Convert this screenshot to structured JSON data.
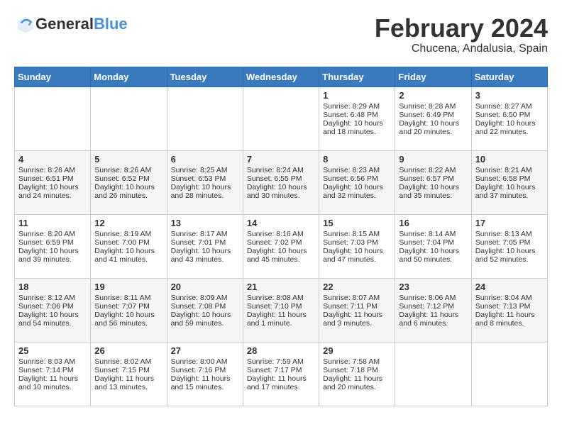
{
  "header": {
    "logo_general": "General",
    "logo_blue": "Blue",
    "title": "February 2024",
    "subtitle": "Chucena, Andalusia, Spain"
  },
  "weekdays": [
    "Sunday",
    "Monday",
    "Tuesday",
    "Wednesday",
    "Thursday",
    "Friday",
    "Saturday"
  ],
  "weeks": [
    [
      {
        "day": "",
        "empty": true
      },
      {
        "day": "",
        "empty": true
      },
      {
        "day": "",
        "empty": true
      },
      {
        "day": "",
        "empty": true
      },
      {
        "day": "1",
        "sunrise": "Sunrise: 8:29 AM",
        "sunset": "Sunset: 6:48 PM",
        "daylight": "Daylight: 10 hours and 18 minutes."
      },
      {
        "day": "2",
        "sunrise": "Sunrise: 8:28 AM",
        "sunset": "Sunset: 6:49 PM",
        "daylight": "Daylight: 10 hours and 20 minutes."
      },
      {
        "day": "3",
        "sunrise": "Sunrise: 8:27 AM",
        "sunset": "Sunset: 6:50 PM",
        "daylight": "Daylight: 10 hours and 22 minutes."
      }
    ],
    [
      {
        "day": "4",
        "sunrise": "Sunrise: 8:26 AM",
        "sunset": "Sunset: 6:51 PM",
        "daylight": "Daylight: 10 hours and 24 minutes."
      },
      {
        "day": "5",
        "sunrise": "Sunrise: 8:26 AM",
        "sunset": "Sunset: 6:52 PM",
        "daylight": "Daylight: 10 hours and 26 minutes."
      },
      {
        "day": "6",
        "sunrise": "Sunrise: 8:25 AM",
        "sunset": "Sunset: 6:53 PM",
        "daylight": "Daylight: 10 hours and 28 minutes."
      },
      {
        "day": "7",
        "sunrise": "Sunrise: 8:24 AM",
        "sunset": "Sunset: 6:55 PM",
        "daylight": "Daylight: 10 hours and 30 minutes."
      },
      {
        "day": "8",
        "sunrise": "Sunrise: 8:23 AM",
        "sunset": "Sunset: 6:56 PM",
        "daylight": "Daylight: 10 hours and 32 minutes."
      },
      {
        "day": "9",
        "sunrise": "Sunrise: 8:22 AM",
        "sunset": "Sunset: 6:57 PM",
        "daylight": "Daylight: 10 hours and 35 minutes."
      },
      {
        "day": "10",
        "sunrise": "Sunrise: 8:21 AM",
        "sunset": "Sunset: 6:58 PM",
        "daylight": "Daylight: 10 hours and 37 minutes."
      }
    ],
    [
      {
        "day": "11",
        "sunrise": "Sunrise: 8:20 AM",
        "sunset": "Sunset: 6:59 PM",
        "daylight": "Daylight: 10 hours and 39 minutes."
      },
      {
        "day": "12",
        "sunrise": "Sunrise: 8:19 AM",
        "sunset": "Sunset: 7:00 PM",
        "daylight": "Daylight: 10 hours and 41 minutes."
      },
      {
        "day": "13",
        "sunrise": "Sunrise: 8:17 AM",
        "sunset": "Sunset: 7:01 PM",
        "daylight": "Daylight: 10 hours and 43 minutes."
      },
      {
        "day": "14",
        "sunrise": "Sunrise: 8:16 AM",
        "sunset": "Sunset: 7:02 PM",
        "daylight": "Daylight: 10 hours and 45 minutes."
      },
      {
        "day": "15",
        "sunrise": "Sunrise: 8:15 AM",
        "sunset": "Sunset: 7:03 PM",
        "daylight": "Daylight: 10 hours and 47 minutes."
      },
      {
        "day": "16",
        "sunrise": "Sunrise: 8:14 AM",
        "sunset": "Sunset: 7:04 PM",
        "daylight": "Daylight: 10 hours and 50 minutes."
      },
      {
        "day": "17",
        "sunrise": "Sunrise: 8:13 AM",
        "sunset": "Sunset: 7:05 PM",
        "daylight": "Daylight: 10 hours and 52 minutes."
      }
    ],
    [
      {
        "day": "18",
        "sunrise": "Sunrise: 8:12 AM",
        "sunset": "Sunset: 7:06 PM",
        "daylight": "Daylight: 10 hours and 54 minutes."
      },
      {
        "day": "19",
        "sunrise": "Sunrise: 8:11 AM",
        "sunset": "Sunset: 7:07 PM",
        "daylight": "Daylight: 10 hours and 56 minutes."
      },
      {
        "day": "20",
        "sunrise": "Sunrise: 8:09 AM",
        "sunset": "Sunset: 7:08 PM",
        "daylight": "Daylight: 10 hours and 59 minutes."
      },
      {
        "day": "21",
        "sunrise": "Sunrise: 8:08 AM",
        "sunset": "Sunset: 7:10 PM",
        "daylight": "Daylight: 11 hours and 1 minute."
      },
      {
        "day": "22",
        "sunrise": "Sunrise: 8:07 AM",
        "sunset": "Sunset: 7:11 PM",
        "daylight": "Daylight: 11 hours and 3 minutes."
      },
      {
        "day": "23",
        "sunrise": "Sunrise: 8:06 AM",
        "sunset": "Sunset: 7:12 PM",
        "daylight": "Daylight: 11 hours and 6 minutes."
      },
      {
        "day": "24",
        "sunrise": "Sunrise: 8:04 AM",
        "sunset": "Sunset: 7:13 PM",
        "daylight": "Daylight: 11 hours and 8 minutes."
      }
    ],
    [
      {
        "day": "25",
        "sunrise": "Sunrise: 8:03 AM",
        "sunset": "Sunset: 7:14 PM",
        "daylight": "Daylight: 11 hours and 10 minutes."
      },
      {
        "day": "26",
        "sunrise": "Sunrise: 8:02 AM",
        "sunset": "Sunset: 7:15 PM",
        "daylight": "Daylight: 11 hours and 13 minutes."
      },
      {
        "day": "27",
        "sunrise": "Sunrise: 8:00 AM",
        "sunset": "Sunset: 7:16 PM",
        "daylight": "Daylight: 11 hours and 15 minutes."
      },
      {
        "day": "28",
        "sunrise": "Sunrise: 7:59 AM",
        "sunset": "Sunset: 7:17 PM",
        "daylight": "Daylight: 11 hours and 17 minutes."
      },
      {
        "day": "29",
        "sunrise": "Sunrise: 7:58 AM",
        "sunset": "Sunset: 7:18 PM",
        "daylight": "Daylight: 11 hours and 20 minutes."
      },
      {
        "day": "",
        "empty": true
      },
      {
        "day": "",
        "empty": true
      }
    ]
  ]
}
